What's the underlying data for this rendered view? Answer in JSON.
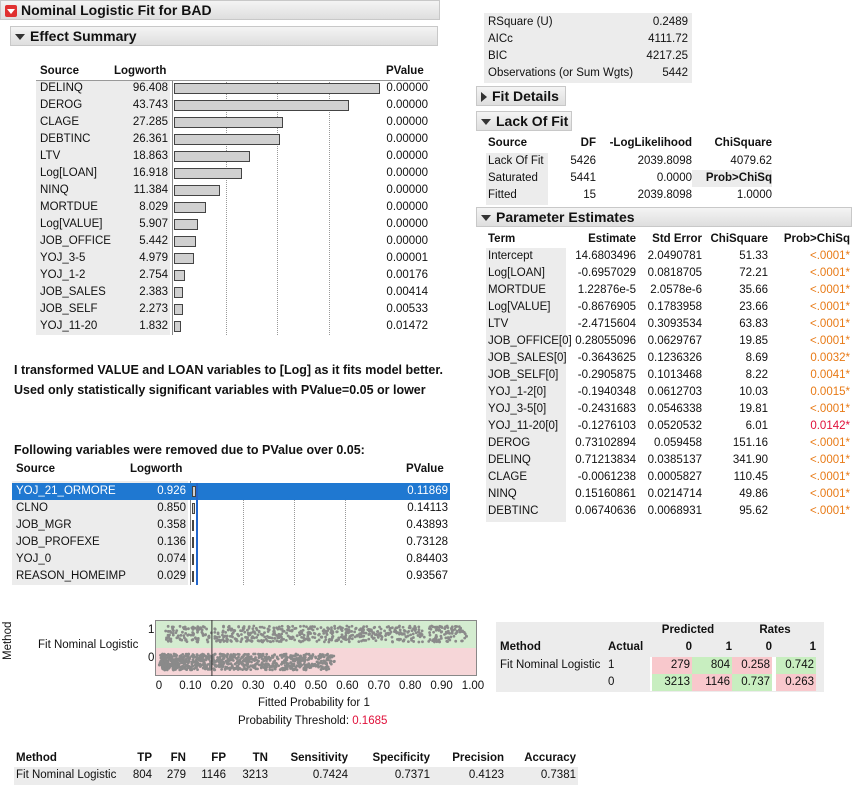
{
  "main_title": "Nominal Logistic Fit for BAD",
  "effect_summary": {
    "title": "Effect Summary",
    "headers": [
      "Source",
      "Logworth",
      "PValue"
    ],
    "rows": [
      {
        "source": "DELINQ",
        "logworth": "96.408",
        "pvalue": "0.00000",
        "frac": 1.0
      },
      {
        "source": "DEROG",
        "logworth": "43.743",
        "pvalue": "0.00000",
        "frac": 0.851
      },
      {
        "source": "CLAGE",
        "logworth": "27.285",
        "pvalue": "0.00000",
        "frac": 0.531
      },
      {
        "source": "DEBTINC",
        "logworth": "26.361",
        "pvalue": "0.00000",
        "frac": 0.513
      },
      {
        "source": "LTV",
        "logworth": "18.863",
        "pvalue": "0.00000",
        "frac": 0.367
      },
      {
        "source": "Log[LOAN]",
        "logworth": "16.918",
        "pvalue": "0.00000",
        "frac": 0.329
      },
      {
        "source": "NINQ",
        "logworth": "11.384",
        "pvalue": "0.00000",
        "frac": 0.222
      },
      {
        "source": "MORTDUE",
        "logworth": "8.029",
        "pvalue": "0.00000",
        "frac": 0.156
      },
      {
        "source": "Log[VALUE]",
        "logworth": "5.907",
        "pvalue": "0.00000",
        "frac": 0.115
      },
      {
        "source": "JOB_OFFICE",
        "logworth": "5.442",
        "pvalue": "0.00000",
        "frac": 0.106
      },
      {
        "source": "YOJ_3-5",
        "logworth": "4.979",
        "pvalue": "0.00001",
        "frac": 0.097
      },
      {
        "source": "YOJ_1-2",
        "logworth": "2.754",
        "pvalue": "0.00176",
        "frac": 0.054
      },
      {
        "source": "JOB_SALES",
        "logworth": "2.383",
        "pvalue": "0.00414",
        "frac": 0.046
      },
      {
        "source": "JOB_SELF",
        "logworth": "2.273",
        "pvalue": "0.00533",
        "frac": 0.044
      },
      {
        "source": "YOJ_11-20",
        "logworth": "1.832",
        "pvalue": "0.01472",
        "frac": 0.036
      }
    ]
  },
  "note_line1": "I transformed VALUE and LOAN variables to [Log] as it fits model better.",
  "note_line2": "Used only statistically significant variables with PValue=0.05 or lower",
  "removed_title": "Following variables were removed due to PValue over 0.05:",
  "removed": {
    "headers": [
      "Source",
      "Logworth",
      "PValue"
    ],
    "rows": [
      {
        "source": "YOJ_21_ORMORE",
        "logworth": "0.926",
        "pvalue": "0.11869",
        "frac": 0.019,
        "selected": true
      },
      {
        "source": "CLNO",
        "logworth": "0.850",
        "pvalue": "0.14113",
        "frac": 0.017
      },
      {
        "source": "JOB_MGR",
        "logworth": "0.358",
        "pvalue": "0.43893",
        "frac": 0.007
      },
      {
        "source": "JOB_PROFEXE",
        "logworth": "0.136",
        "pvalue": "0.73128",
        "frac": 0.003
      },
      {
        "source": "YOJ_0",
        "logworth": "0.074",
        "pvalue": "0.84403",
        "frac": 0.002
      },
      {
        "source": "REASON_HOMEIMP",
        "logworth": "0.029",
        "pvalue": "0.93567",
        "frac": 0.001
      }
    ]
  },
  "fit_stats": [
    {
      "label": "RSquare (U)",
      "value": "0.2489"
    },
    {
      "label": "AICc",
      "value": "4111.72"
    },
    {
      "label": "BIC",
      "value": "4217.25"
    },
    {
      "label": "Observations (or Sum Wgts)",
      "value": "5442"
    }
  ],
  "fit_details_title": "Fit Details",
  "lack_of_fit": {
    "title": "Lack Of Fit",
    "headers": [
      "Source",
      "DF",
      "-LogLikelihood",
      "ChiSquare"
    ],
    "rows": [
      {
        "source": "Lack Of Fit",
        "df": "5426",
        "ll": "2039.8098",
        "chi": "4079.62"
      },
      {
        "source": "Saturated",
        "df": "5441",
        "ll": "0.0000",
        "chi": "Prob>ChiSq"
      },
      {
        "source": "Fitted",
        "df": "15",
        "ll": "2039.8098",
        "chi": "1.0000"
      }
    ]
  },
  "param_estimates": {
    "title": "Parameter Estimates",
    "headers": [
      "Term",
      "Estimate",
      "Std Error",
      "ChiSquare",
      "Prob>ChiSq"
    ],
    "rows": [
      {
        "term": "Intercept",
        "est": "14.6803496",
        "se": "2.0490781",
        "chi": "51.33",
        "p": "<.0001*",
        "red": false
      },
      {
        "term": "Log[LOAN]",
        "est": "-0.6957029",
        "se": "0.0818705",
        "chi": "72.21",
        "p": "<.0001*",
        "red": false
      },
      {
        "term": "MORTDUE",
        "est": "1.22876e-5",
        "se": "2.0578e-6",
        "chi": "35.66",
        "p": "<.0001*",
        "red": false
      },
      {
        "term": "Log[VALUE]",
        "est": "-0.8676905",
        "se": "0.1783958",
        "chi": "23.66",
        "p": "<.0001*",
        "red": false
      },
      {
        "term": "LTV",
        "est": "-2.4715604",
        "se": "0.3093534",
        "chi": "63.83",
        "p": "<.0001*",
        "red": false
      },
      {
        "term": "JOB_OFFICE[0]",
        "est": "0.28055096",
        "se": "0.0629767",
        "chi": "19.85",
        "p": "<.0001*",
        "red": false
      },
      {
        "term": "JOB_SALES[0]",
        "est": "-0.3643625",
        "se": "0.1236326",
        "chi": "8.69",
        "p": "0.0032*",
        "red": false
      },
      {
        "term": "JOB_SELF[0]",
        "est": "-0.2905875",
        "se": "0.1013468",
        "chi": "8.22",
        "p": "0.0041*",
        "red": false
      },
      {
        "term": "YOJ_1-2[0]",
        "est": "-0.1940348",
        "se": "0.0612703",
        "chi": "10.03",
        "p": "0.0015*",
        "red": false
      },
      {
        "term": "YOJ_3-5[0]",
        "est": "-0.2431683",
        "se": "0.0546338",
        "chi": "19.81",
        "p": "<.0001*",
        "red": false
      },
      {
        "term": "YOJ_11-20[0]",
        "est": "-0.1276103",
        "se": "0.0520532",
        "chi": "6.01",
        "p": "0.0142*",
        "red": true
      },
      {
        "term": "DEROG",
        "est": "0.73102894",
        "se": "0.059458",
        "chi": "151.16",
        "p": "<.0001*",
        "red": false
      },
      {
        "term": "DELINQ",
        "est": "0.71213834",
        "se": "0.0385137",
        "chi": "341.90",
        "p": "<.0001*",
        "red": false
      },
      {
        "term": "CLAGE",
        "est": "-0.0061238",
        "se": "0.0005827",
        "chi": "110.45",
        "p": "<.0001*",
        "red": false
      },
      {
        "term": "NINQ",
        "est": "0.15160861",
        "se": "0.0214714",
        "chi": "49.86",
        "p": "<.0001*",
        "red": false
      },
      {
        "term": "DEBTINC",
        "est": "0.06740636",
        "se": "0.0068931",
        "chi": "95.62",
        "p": "<.0001*",
        "red": false
      }
    ]
  },
  "fitplot": {
    "method_vertical": "Method",
    "method_label": "Fit Nominal Logistic",
    "y_levels": [
      "1",
      "0"
    ],
    "x_ticks": [
      "0",
      "0.10",
      "0.20",
      "0.30",
      "0.40",
      "0.50",
      "0.60",
      "0.70",
      "0.80",
      "0.90",
      "1.00"
    ],
    "xlabel": "Fitted Probability for 1",
    "threshold_label": "Probability Threshold:",
    "threshold_value": "0.1685",
    "threshold": 0.1685,
    "colors": {
      "upper": "#d4ecd0",
      "lower": "#f6d6d8",
      "points": "#8a8a8a",
      "threshold": "#333333"
    }
  },
  "confusion": {
    "predicted_label": "Predicted",
    "rates_label": "Rates",
    "method_header": "Method",
    "actual_header": "Actual",
    "cols": [
      "0",
      "1",
      "0",
      "1"
    ],
    "method": "Fit Nominal Logistic",
    "rows": [
      {
        "actual": "1",
        "p0": "279",
        "p1": "804",
        "r0": "0.258",
        "r1": "0.742"
      },
      {
        "actual": "0",
        "p0": "3213",
        "p1": "1146",
        "r0": "0.737",
        "r1": "0.263"
      }
    ]
  },
  "metrics": {
    "headers": [
      "Method",
      "TP",
      "FN",
      "FP",
      "TN",
      "Sensitivity",
      "Specificity",
      "Precision",
      "Accuracy"
    ],
    "row": [
      "Fit Nominal Logistic",
      "804",
      "279",
      "1146",
      "3213",
      "0.7424",
      "0.7371",
      "0.4123",
      "0.7381"
    ]
  }
}
